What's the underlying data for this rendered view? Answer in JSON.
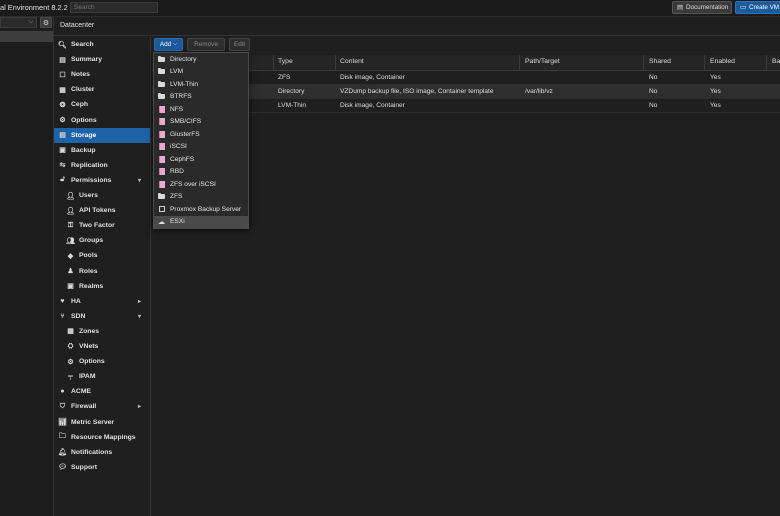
{
  "header": {
    "title_fragment": "al Environment 8.2.2",
    "search_placeholder": "Search",
    "documentation_label": "Documentation",
    "create_vm_label": "Create VM"
  },
  "breadcrumb": {
    "title": "Datacenter"
  },
  "menu": [
    {
      "label": "Search",
      "icon": "search-icon",
      "glyph": "🔍︎",
      "indent": 0
    },
    {
      "label": "Summary",
      "icon": "book-icon",
      "glyph": "▤",
      "indent": 0
    },
    {
      "label": "Notes",
      "icon": "notes-icon",
      "glyph": "☐",
      "indent": 0
    },
    {
      "label": "Cluster",
      "icon": "server-icon",
      "glyph": "▦",
      "indent": 0
    },
    {
      "label": "Ceph",
      "icon": "ceph-icon",
      "glyph": "❂",
      "indent": 0
    },
    {
      "label": "Options",
      "icon": "gear-icon",
      "glyph": "⚙",
      "indent": 0
    },
    {
      "label": "Storage",
      "icon": "database-icon",
      "glyph": "▤",
      "indent": 0,
      "active": true
    },
    {
      "label": "Backup",
      "icon": "floppy-icon",
      "glyph": "▣",
      "indent": 0
    },
    {
      "label": "Replication",
      "icon": "retweet-icon",
      "glyph": "⇆",
      "indent": 0
    },
    {
      "label": "Permissions",
      "icon": "unlock-icon",
      "glyph": "🔓︎",
      "indent": 0,
      "arrow": "▾"
    },
    {
      "label": "Users",
      "icon": "user-icon",
      "glyph": "👤︎",
      "indent": 1
    },
    {
      "label": "API Tokens",
      "icon": "user-o-icon",
      "glyph": "👤︎",
      "indent": 1
    },
    {
      "label": "Two Factor",
      "icon": "key-icon",
      "glyph": "⚿",
      "indent": 1
    },
    {
      "label": "Groups",
      "icon": "users-icon",
      "glyph": "👥︎",
      "indent": 1
    },
    {
      "label": "Pools",
      "icon": "tags-icon",
      "glyph": "◆",
      "indent": 1
    },
    {
      "label": "Roles",
      "icon": "male-icon",
      "glyph": "♟",
      "indent": 1
    },
    {
      "label": "Realms",
      "icon": "address-book-icon",
      "glyph": "▣",
      "indent": 1
    },
    {
      "label": "HA",
      "icon": "heartbeat-icon",
      "glyph": "♥",
      "indent": 0,
      "arrow": "▸"
    },
    {
      "label": "SDN",
      "icon": "sdn-icon",
      "glyph": "⑂",
      "indent": 0,
      "arrow": "▾"
    },
    {
      "label": "Zones",
      "icon": "th-icon",
      "glyph": "▦",
      "indent": 1
    },
    {
      "label": "VNets",
      "icon": "network-icon",
      "glyph": "⛭",
      "indent": 1
    },
    {
      "label": "Options",
      "icon": "gear-icon",
      "glyph": "⚙",
      "indent": 1
    },
    {
      "label": "IPAM",
      "icon": "ipam-icon",
      "glyph": "╤",
      "indent": 1
    },
    {
      "label": "ACME",
      "icon": "certificate-icon",
      "glyph": "●",
      "indent": 0
    },
    {
      "label": "Firewall",
      "icon": "shield-icon",
      "glyph": "⛉",
      "indent": 0,
      "arrow": "▸"
    },
    {
      "label": "Metric Server",
      "icon": "bar-chart-icon",
      "glyph": "📊︎",
      "indent": 0
    },
    {
      "label": "Resource Mappings",
      "icon": "folder-icon",
      "glyph": "🗀",
      "indent": 0
    },
    {
      "label": "Notifications",
      "icon": "bell-icon",
      "glyph": "🔔︎",
      "indent": 0
    },
    {
      "label": "Support",
      "icon": "comments-icon",
      "glyph": "💬︎",
      "indent": 0
    }
  ],
  "toolbar": {
    "add_label": "Add",
    "remove_label": "Remove",
    "edit_label": "Edit"
  },
  "grid": {
    "columns": [
      "Type",
      "Content",
      "Path/Target",
      "Shared",
      "Enabled",
      "Ba"
    ],
    "rows": [
      {
        "type": "ZFS",
        "content": "Disk image, Container",
        "path": "",
        "shared": "No",
        "enabled": "Yes"
      },
      {
        "type": "Directory",
        "content": "VZDump backup file, ISO image, Container template",
        "path": "/var/lib/vz",
        "shared": "No",
        "enabled": "Yes"
      },
      {
        "type": "LVM-Thin",
        "content": "Disk image, Container",
        "path": "",
        "shared": "No",
        "enabled": "Yes"
      }
    ]
  },
  "add_menu": [
    {
      "label": "Directory",
      "icon": "folder-icon",
      "kind": "folder"
    },
    {
      "label": "LVM",
      "icon": "folder-icon",
      "kind": "folder"
    },
    {
      "label": "LVM-Thin",
      "icon": "folder-icon",
      "kind": "folder"
    },
    {
      "label": "BTRFS",
      "icon": "folder-icon",
      "kind": "folder"
    },
    {
      "label": "NFS",
      "icon": "database-icon",
      "kind": "db"
    },
    {
      "label": "SMB/CIFS",
      "icon": "database-icon",
      "kind": "db"
    },
    {
      "label": "GlusterFS",
      "icon": "database-icon",
      "kind": "db"
    },
    {
      "label": "iSCSI",
      "icon": "database-icon",
      "kind": "db"
    },
    {
      "label": "CephFS",
      "icon": "database-icon",
      "kind": "db"
    },
    {
      "label": "RBD",
      "icon": "database-icon",
      "kind": "db"
    },
    {
      "label": "ZFS over iSCSI",
      "icon": "database-icon",
      "kind": "db"
    },
    {
      "label": "ZFS",
      "icon": "folder-icon",
      "kind": "folder"
    },
    {
      "label": "Proxmox Backup Server",
      "icon": "floppy-icon",
      "kind": "disk"
    },
    {
      "label": "ESXi",
      "icon": "cloud-icon",
      "kind": "cloud",
      "highlight": true
    }
  ]
}
